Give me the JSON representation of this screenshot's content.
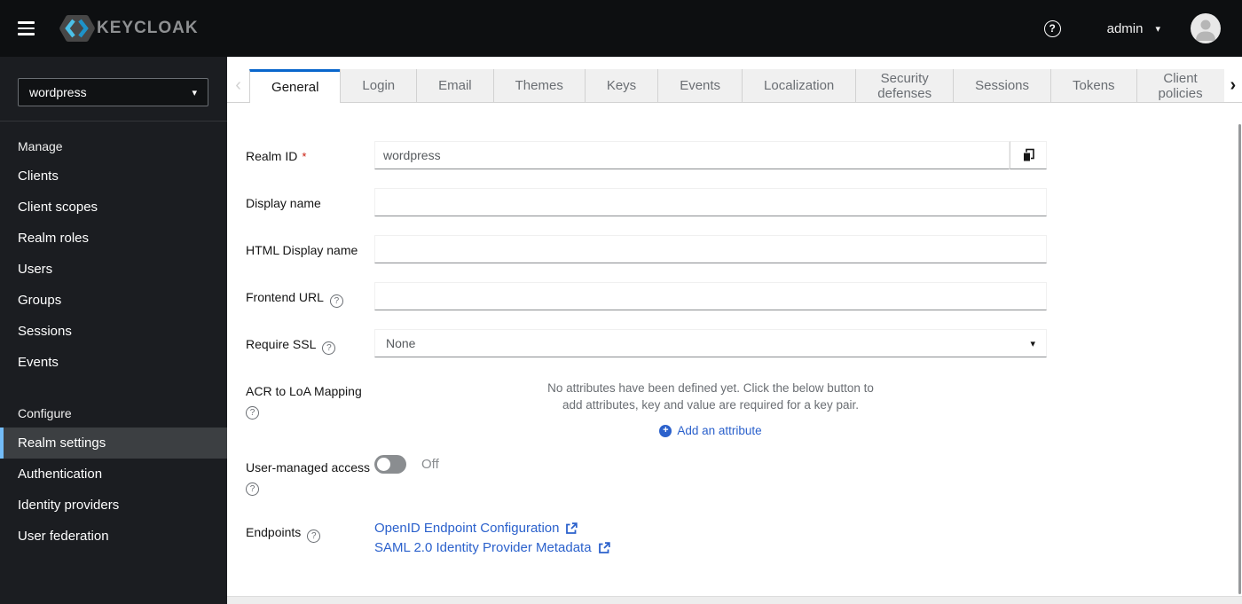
{
  "masthead": {
    "brand": "KEYCLOAK",
    "username": "admin"
  },
  "icons": {
    "help": "?",
    "caret_down": "▾",
    "scroll_left": "‹",
    "scroll_right": "›",
    "plus": "+",
    "required_mark": "*"
  },
  "sidebar": {
    "realm_select_value": "wordpress",
    "manage": {
      "label": "Manage",
      "items": [
        "Clients",
        "Client scopes",
        "Realm roles",
        "Users",
        "Groups",
        "Sessions",
        "Events"
      ]
    },
    "configure": {
      "label": "Configure",
      "items": [
        "Realm settings",
        "Authentication",
        "Identity providers",
        "User federation"
      ],
      "selected": "Realm settings"
    }
  },
  "tabs": {
    "active": "General",
    "items": [
      "General",
      "Login",
      "Email",
      "Themes",
      "Keys",
      "Events",
      "Localization",
      "Security defenses",
      "Sessions",
      "Tokens",
      "Client policies"
    ]
  },
  "form": {
    "realm_id": {
      "label": "Realm ID",
      "value": "wordpress"
    },
    "display_name": {
      "label": "Display name",
      "value": ""
    },
    "html_display_name": {
      "label": "HTML Display name",
      "value": ""
    },
    "frontend_url": {
      "label": "Frontend URL",
      "value": ""
    },
    "require_ssl": {
      "label": "Require SSL",
      "value": "None"
    },
    "acr_mapping": {
      "label": "ACR to LoA Mapping",
      "empty_text": "No attributes have been defined yet. Click the below button to add attributes, key and value are required for a key pair.",
      "add_button": "Add an attribute"
    },
    "user_managed_access": {
      "label": "User-managed access",
      "state": "Off"
    },
    "endpoints": {
      "label": "Endpoints",
      "links": [
        "OpenID Endpoint Configuration",
        "SAML 2.0 Identity Provider Metadata"
      ]
    }
  },
  "colors": {
    "masthead_bg": "#0d0f11",
    "sidebar_bg": "#1b1d21",
    "nav_selected_bg": "#3c3f42",
    "nav_selected_border": "#73bcf7",
    "tab_active_border": "#0966cc",
    "link": "#2b61cc",
    "required": "#c9190b",
    "toggle_off": "#8a8d90"
  }
}
